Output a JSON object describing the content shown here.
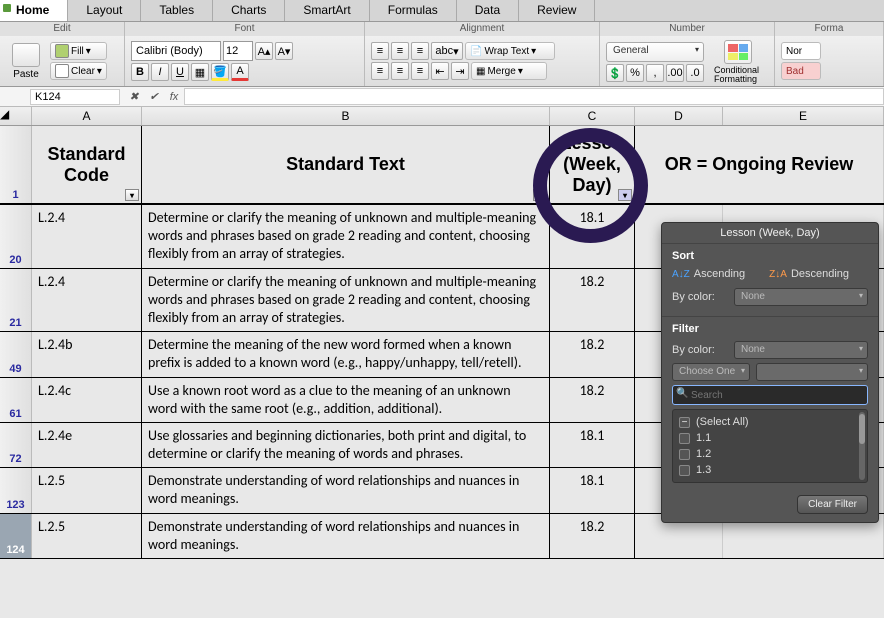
{
  "tabs": [
    "Home",
    "Layout",
    "Tables",
    "Charts",
    "SmartArt",
    "Formulas",
    "Data",
    "Review"
  ],
  "activeTab": "Home",
  "groups": {
    "edit": "Edit",
    "font": "Font",
    "alignment": "Alignment",
    "number": "Number",
    "format": "Forma"
  },
  "edit": {
    "fill": "Fill",
    "clear": "Clear",
    "paste": "Paste"
  },
  "font": {
    "name": "Calibri (Body)",
    "size": "12",
    "bold": "B",
    "italic": "I",
    "underline": "U"
  },
  "align": {
    "wrap": "Wrap Text",
    "merge": "Merge",
    "abc": "abc"
  },
  "number": {
    "fmt": "General",
    "cond": "Conditional Formatting",
    "pct": "%",
    "comma": ",",
    "currency": "$"
  },
  "format": {
    "normal": "Nor",
    "bad": "Bad"
  },
  "namebox": "K124",
  "cols": [
    "A",
    "B",
    "C",
    "D",
    "E"
  ],
  "headers": {
    "A": "Standard Code",
    "B": "Standard Text",
    "C": "Lesson (Week, Day)",
    "DE": "OR = Ongoing Review"
  },
  "rows": [
    {
      "n": "1",
      "header": true
    },
    {
      "n": "20",
      "code": "L.2.4",
      "text": "Determine or clarify the meaning of unknown and multiple-meaning words and phrases based on grade 2 reading and content, choosing flexibly from an array of strategies.",
      "lesson": "18.1"
    },
    {
      "n": "21",
      "code": "L.2.4",
      "text": "Determine or clarify the meaning of unknown and multiple-meaning words and phrases based on grade 2 reading and content, choosing flexibly from an array of strategies.",
      "lesson": "18.2"
    },
    {
      "n": "49",
      "code": "L.2.4b",
      "text": "Determine the meaning of the new word formed when a known prefix is added to a known word (e.g., happy/unhappy, tell/retell).",
      "lesson": "18.2"
    },
    {
      "n": "61",
      "code": "L.2.4c",
      "text": "Use a known root word as a clue to the meaning of an unknown word with the same root (e.g., addition, additional).",
      "lesson": "18.2"
    },
    {
      "n": "72",
      "code": "L.2.4e",
      "text": "Use glossaries and beginning dictionaries, both print and digital, to determine or clarify the meaning of words and phrases.",
      "lesson": "18.1"
    },
    {
      "n": "123",
      "code": "L.2.5",
      "text": "Demonstrate understanding of word relationships and nuances in word meanings.",
      "lesson": "18.1"
    },
    {
      "n": "124",
      "code": "L.2.5",
      "text": "Demonstrate understanding of word relationships and nuances in word meanings.",
      "lesson": "18.2",
      "sel": true
    }
  ],
  "popup": {
    "title": "Lesson (Week, Day)",
    "sort": "Sort",
    "asc": "Ascending",
    "desc": "Descending",
    "bycolor": "By color:",
    "none": "None",
    "filter": "Filter",
    "choose": "Choose One",
    "search": "Search",
    "items": [
      "(Select All)",
      "1.1",
      "1.2",
      "1.3"
    ],
    "clear": "Clear Filter"
  }
}
